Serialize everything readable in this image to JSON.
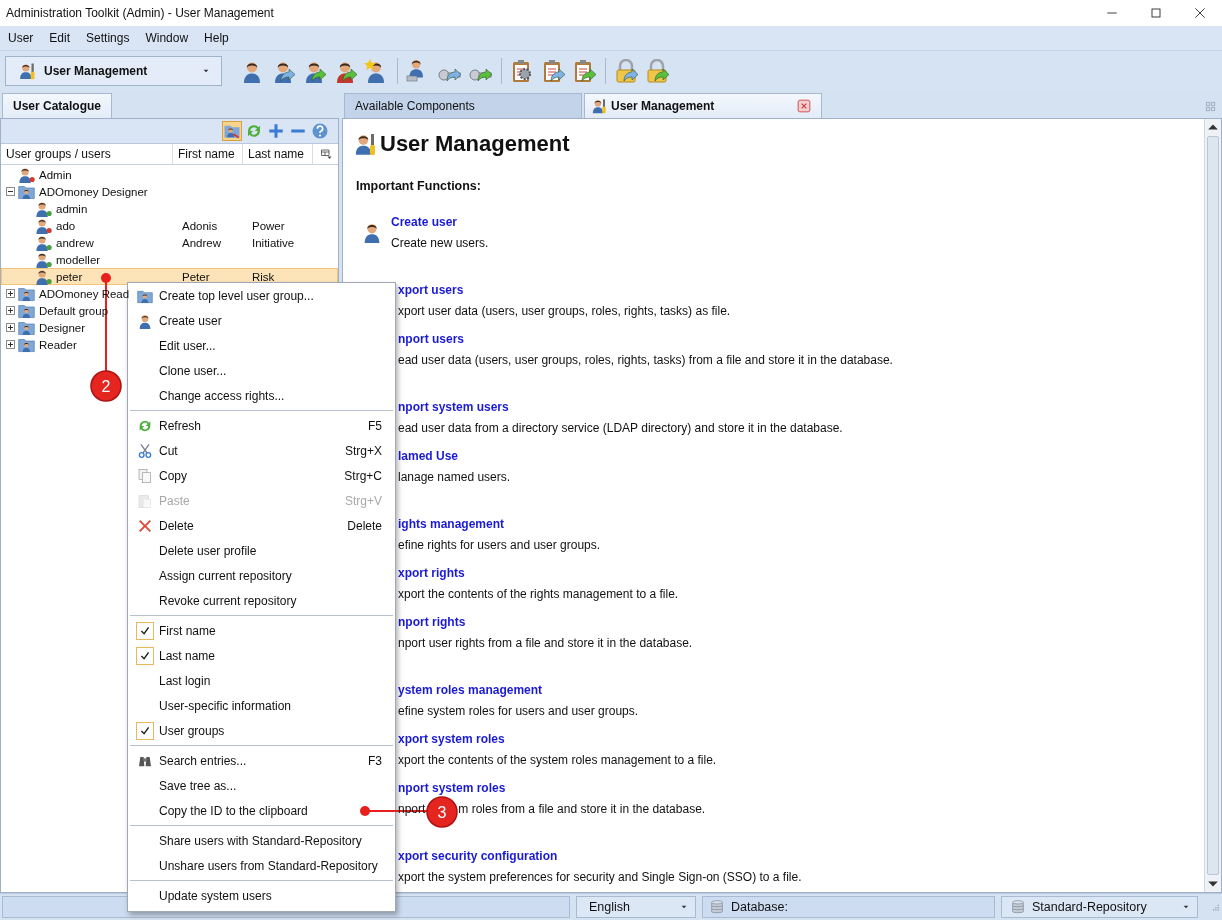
{
  "window": {
    "title": "Administration Toolkit (Admin) - User Management"
  },
  "menu_bar": [
    "User",
    "Edit",
    "Settings",
    "Window",
    "Help"
  ],
  "toolbar": {
    "view_selector": "User Management"
  },
  "left_pane": {
    "tab": {
      "label": "User Catalogue",
      "selected": true
    },
    "filter_toggle": {
      "on": true
    },
    "tree": {
      "columns": [
        "User groups / users",
        "First name",
        "Last name"
      ],
      "rows": [
        {
          "kind": "user",
          "name": "Admin",
          "color": "#d83a2e",
          "selected": false
        },
        {
          "kind": "group",
          "name": "ADOmoney Designer",
          "expanded": true,
          "selected": false,
          "children": [
            {
              "kind": "user",
              "name": "admin",
              "color": "#4aa03c",
              "selected": false
            },
            {
              "kind": "user",
              "name": "ado",
              "first_name": "Adonis",
              "last_name": "Power",
              "color": "#d83a2e",
              "selected": false
            },
            {
              "kind": "user",
              "name": "andrew",
              "first_name": "Andrew",
              "last_name": "Initiative",
              "color": "#4aa03c",
              "selected": false
            },
            {
              "kind": "user",
              "name": "modeller",
              "color": "#4aa03c",
              "selected": false
            },
            {
              "kind": "user",
              "name": "peter",
              "first_name": "Peter",
              "last_name": "Risk",
              "color": "#4aa03c",
              "selected": true
            }
          ]
        },
        {
          "kind": "group",
          "name": "ADOmoney Read",
          "expanded": false,
          "selected": false
        },
        {
          "kind": "group",
          "name": "Default group",
          "expanded": false,
          "selected": false
        },
        {
          "kind": "group",
          "name": "Designer",
          "expanded": false,
          "selected": false
        },
        {
          "kind": "group",
          "name": "Reader",
          "expanded": false,
          "selected": false
        }
      ]
    }
  },
  "right_pane": {
    "tabs": [
      {
        "label": "Available Components",
        "selected": false,
        "closable": false
      },
      {
        "label": "User Management",
        "selected": true,
        "closable": true
      }
    ],
    "content": {
      "title": "User Management",
      "subtitle": "Important Functions:",
      "sections": [
        {
          "items": [
            {
              "title": "Create user",
              "description": "Create new users."
            }
          ]
        },
        {
          "items": [
            {
              "title": "xport users",
              "description": "xport user data (users, user groups, roles, rights, tasks) as file."
            },
            {
              "title": "nport users",
              "description": "ead user data (users, user groups, roles, rights, tasks) from a file and store it in the database."
            }
          ]
        },
        {
          "items": [
            {
              "title": "nport system users",
              "description": "ead user data from a directory service (LDAP directory) and store it in the database."
            },
            {
              "title": "lamed Use",
              "description": "lanage named users."
            }
          ]
        },
        {
          "items": [
            {
              "title": "ights management",
              "description": "efine rights for users and user groups."
            },
            {
              "title": "xport rights",
              "description": "xport the contents of the rights management to a file."
            },
            {
              "title": "nport rights",
              "description": "nport user rights from a file and store it in the database."
            }
          ]
        },
        {
          "items": [
            {
              "title": "ystem roles management",
              "description": "efine system roles for users and user groups."
            },
            {
              "title": "xport system roles",
              "description": "xport the contents of the system roles management to a file."
            },
            {
              "title": "nport system roles",
              "description_parts": [
                "nport",
                "m roles from a file and store it in the database."
              ]
            }
          ]
        },
        {
          "items": [
            {
              "title": "xport security configuration",
              "description": "xport the system preferences for security and Single Sign-on (SSO) to a file."
            }
          ]
        }
      ]
    }
  },
  "context_menu": {
    "items": [
      {
        "kind": "item",
        "label": "Create top level user group...",
        "disabled": false
      },
      {
        "kind": "item",
        "label": "Create user",
        "disabled": false
      },
      {
        "kind": "item",
        "label": "Edit user...",
        "disabled": false
      },
      {
        "kind": "item",
        "label": "Clone user...",
        "disabled": false
      },
      {
        "kind": "item",
        "label": "Change access rights...",
        "disabled": false
      },
      {
        "kind": "separator"
      },
      {
        "kind": "item",
        "label": "Refresh",
        "shortcut": "F5",
        "disabled": false
      },
      {
        "kind": "item",
        "label": "Cut",
        "shortcut": "Strg+X",
        "disabled": false
      },
      {
        "kind": "item",
        "label": "Copy",
        "shortcut": "Strg+C",
        "disabled": false
      },
      {
        "kind": "item",
        "label": "Paste",
        "shortcut": "Strg+V",
        "disabled": true
      },
      {
        "kind": "item",
        "label": "Delete",
        "shortcut": "Delete",
        "disabled": false
      },
      {
        "kind": "item",
        "label": "Delete user profile",
        "disabled": false
      },
      {
        "kind": "item",
        "label": "Assign current repository",
        "disabled": false
      },
      {
        "kind": "item",
        "label": "Revoke current repository",
        "disabled": false
      },
      {
        "kind": "separator"
      },
      {
        "kind": "check",
        "label": "First name",
        "checked": true
      },
      {
        "kind": "check",
        "label": "Last name",
        "checked": true
      },
      {
        "kind": "check",
        "label": "Last login",
        "checked": false
      },
      {
        "kind": "check",
        "label": "User-specific information",
        "checked": false
      },
      {
        "kind": "check",
        "label": "User groups",
        "checked": true
      },
      {
        "kind": "separator"
      },
      {
        "kind": "item",
        "label": "Search entries...",
        "shortcut": "F3",
        "disabled": false
      },
      {
        "kind": "item",
        "label": "Save tree as...",
        "disabled": false
      },
      {
        "kind": "item",
        "label": "Copy the ID to the clipboard",
        "disabled": false
      },
      {
        "kind": "separator"
      },
      {
        "kind": "item",
        "label": "Share users with Standard-Repository",
        "disabled": false
      },
      {
        "kind": "item",
        "label": "Unshare users from Standard-Repository",
        "disabled": false
      },
      {
        "kind": "separator"
      },
      {
        "kind": "item",
        "label": "Update system users",
        "disabled": false
      }
    ]
  },
  "callouts": [
    "2",
    "3"
  ],
  "status_bar": {
    "language": "English",
    "database_label": "Database:",
    "repository": "Standard-Repository"
  }
}
